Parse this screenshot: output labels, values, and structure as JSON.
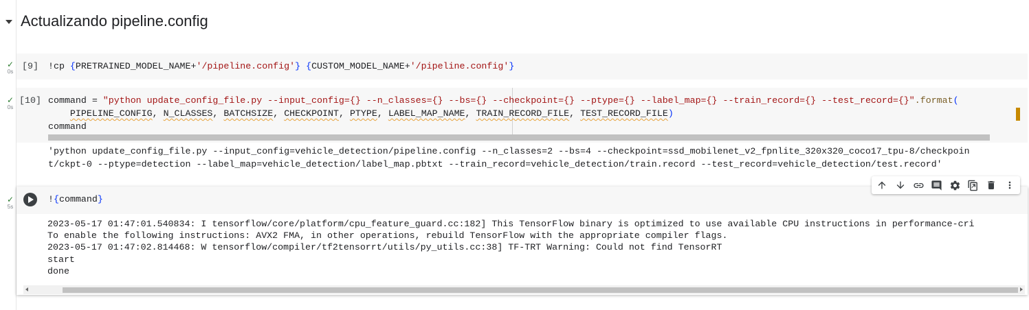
{
  "section": {
    "title": "Actualizando pipeline.config"
  },
  "cells": [
    {
      "exec_count": "[9]",
      "status_time": "0s",
      "code": {
        "bang": "!cp ",
        "brace_open_1": "{",
        "var_1": "PRETRAINED_MODEL_NAME",
        "plus_1": "+",
        "str_1": "'/pipeline.config'",
        "brace_close_1": "}",
        "space": " ",
        "brace_open_2": "{",
        "var_2": "CUSTOM_MODEL_NAME",
        "plus_2": "+",
        "str_2": "'/pipeline.config'",
        "brace_close_2": "}"
      }
    },
    {
      "exec_count": "[10]",
      "status_time": "0s",
      "code": {
        "line1_assign": "command = ",
        "line1_string": "\"python update_config_file.py --input_config={} --n_classes={} --bs={} --checkpoint={} --ptype={} --label_map={} --train_record={} --test_record={}\"",
        "line1_method": ".format",
        "line1_paren": "(",
        "line2_indent": "    ",
        "args": [
          "PIPELINE_CONFIG",
          "N_CLASSES",
          "BATCHSIZE",
          "CHECKPOINT",
          "PTYPE",
          "LABEL_MAP_NAME",
          "TRAIN_RECORD_FILE",
          "TEST_RECORD_FILE"
        ],
        "sep": ", ",
        "line2_close": ")",
        "line3": "command"
      },
      "output": [
        "'python update_config_file.py --input_config=vehicle_detection/pipeline.config --n_classes=2 --bs=4 --checkpoint=ssd_mobilenet_v2_fpnlite_320x320_coco17_tpu-8/checkpoin",
        "t/ckpt-0 --ptype=detection --label_map=vehicle_detection/label_map.pbtxt --train_record=vehicle_detection/train.record --test_record=vehicle_detection/test.record'"
      ]
    },
    {
      "status_time": "5s",
      "code": {
        "bang": "!",
        "open": "{",
        "var": "command",
        "close": "}"
      },
      "output": [
        "2023-05-17 01:47:01.540834: I tensorflow/core/platform/cpu_feature_guard.cc:182] This TensorFlow binary is optimized to use available CPU instructions in performance-cri",
        "To enable the following instructions: AVX2 FMA, in other operations, rebuild TensorFlow with the appropriate compiler flags.",
        "2023-05-17 01:47:02.814468: W tensorflow/compiler/tf2tensorrt/utils/py_utils.cc:38] TF-TRT Warning: Could not find TensorRT",
        "start",
        "done"
      ]
    }
  ],
  "toolbar": {
    "icons": [
      "arrow-up-icon",
      "arrow-down-icon",
      "link-icon",
      "comment-icon",
      "settings-icon",
      "mirror-cell-icon",
      "delete-icon",
      "more-vert-icon"
    ]
  },
  "colors": {
    "string": "#a31515",
    "punct": "#0431fa",
    "method": "#795e26",
    "check": "#2e7d32",
    "warn_underline": "#e7a23b"
  }
}
